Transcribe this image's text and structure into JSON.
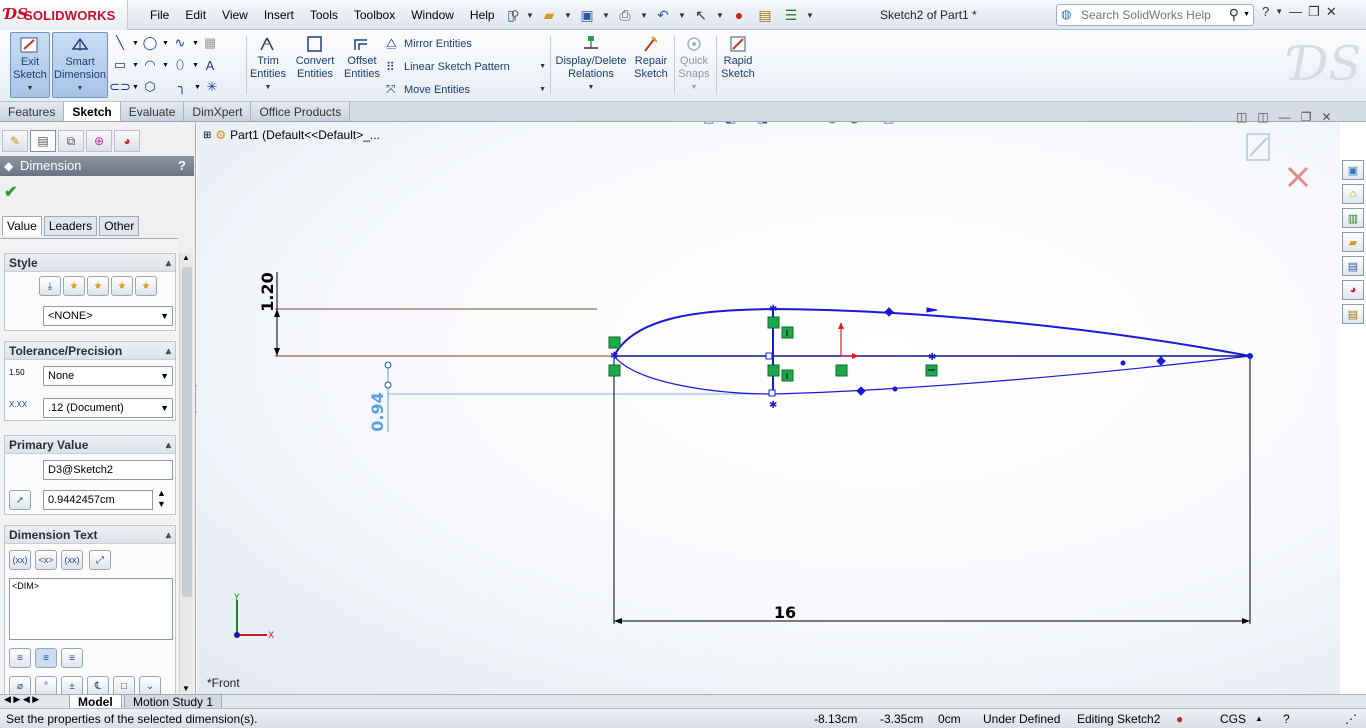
{
  "app": {
    "brand": "SOLIDWORKS",
    "doc_title": "Sketch2 of Part1 *",
    "menu": [
      "File",
      "Edit",
      "View",
      "Insert",
      "Tools",
      "Toolbox",
      "Window",
      "Help"
    ],
    "help_search_placeholder": "Search SolidWorks Help"
  },
  "ribbon": {
    "exit_sketch": [
      "Exit",
      "Sketch"
    ],
    "smart_dimension": [
      "Smart",
      "Dimension"
    ],
    "trim": [
      "Trim",
      "Entities"
    ],
    "convert": [
      "Convert",
      "Entities"
    ],
    "offset": [
      "Offset",
      "Entities"
    ],
    "mirror": "Mirror Entities",
    "linear_pattern": "Linear Sketch Pattern",
    "move": "Move Entities",
    "display_delete": [
      "Display/Delete",
      "Relations"
    ],
    "repair": [
      "Repair",
      "Sketch"
    ],
    "quick_snaps": [
      "Quick",
      "Snaps"
    ],
    "rapid_sketch": [
      "Rapid",
      "Sketch"
    ]
  },
  "cm_tabs": [
    "Features",
    "Sketch",
    "Evaluate",
    "DimXpert",
    "Office Products"
  ],
  "pm": {
    "title": "Dimension",
    "help": "?",
    "tabs": [
      "Value",
      "Leaders",
      "Other"
    ],
    "style": {
      "title": "Style",
      "selected": "<NONE>"
    },
    "tolerance": {
      "title": "Tolerance/Precision",
      "tol_value": "None",
      "precision": ".12 (Document)",
      "tol_icon_text": "1.50",
      "prec_icon_text": "X.XX"
    },
    "primary": {
      "title": "Primary Value",
      "name": "D3@Sketch2",
      "value": "0.9442457cm"
    },
    "dimtext": {
      "title": "Dimension Text",
      "content": "<DIM>",
      "btn_labels": [
        "(xx)",
        "<x>",
        "(xx)",
        "<x>"
      ]
    }
  },
  "graphics": {
    "tree_item": "Part1  (Default<<Default>_...",
    "view_name": "*Front",
    "dimensions": {
      "d1": "1.20",
      "d2": "0.94",
      "d3": "16"
    },
    "axis_x": "X",
    "axis_y": "Y"
  },
  "bottom_tabs": [
    "Model",
    "Motion Study 1"
  ],
  "status": {
    "message": "Set the properties of the selected dimension(s).",
    "x": "-8.13cm",
    "y": "-3.35cm",
    "z": "0cm",
    "state": "Under Defined",
    "editing": "Editing Sketch2",
    "units": "CGS"
  },
  "colors": {
    "accent": "#c8102e",
    "sketch_blue": "#1a1ad6",
    "dim_selected": "#5aa0e6",
    "relation_green": "#19a94a"
  }
}
